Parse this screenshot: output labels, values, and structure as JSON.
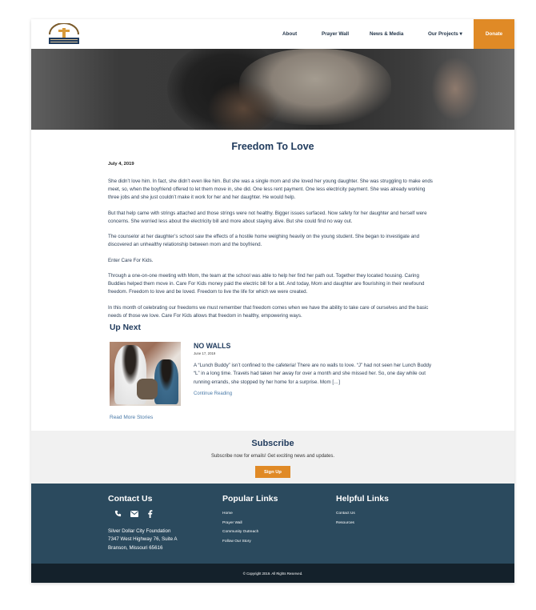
{
  "header": {
    "logo_alt": "Silver Dollar City Foundation",
    "nav": {
      "about": "About",
      "prayer_wall": "Prayer Wall",
      "news_media": "News & Media",
      "our_projects": "Our Projects",
      "donate": "Donate"
    }
  },
  "article": {
    "title": "Freedom To Love",
    "date": "July 4, 2019",
    "paragraphs": [
      "She didn’t love him. In fact, she didn’t even like him. But she was a single mom and she loved her young daughter. She was struggling to make ends meet, so, when the boyfriend offered to let them move in, she did. One less rent payment. One less electricity payment. She was already working three jobs and she just couldn’t make it work for her and her daughter. He would help.",
      "But that help came with strings attached and those strings were not healthy. Bigger issues surfaced. Now safety for her daughter and herself were concerns. She worried less about the electricity bill and more about staying alive. But she could find no way out.",
      "The counselor at her daughter’s school saw the effects of a hostile home weighing heavily on the young student. She began to investigate and discovered an unhealthy relationship between mom and the boyfriend.",
      "Enter Care For Kids.",
      "Through a one-on-one meeting with Mom, the team at the school was able to help her find her path out. Together they located housing. Caring Buddies helped them move in. Care For Kids money paid the electric bill for a bit. And today, Mom and daughter are flourishing in their newfound freedom. Freedom to love and be loved. Freedom to live the life for which we were created.",
      "In this month of celebrating our freedoms we must remember that freedom comes when we have the ability to take care of ourselves and the basic needs of those we love. Care For Kids allows that freedom in healthy, empowering ways."
    ]
  },
  "up_next": {
    "heading": "Up Next",
    "story": {
      "title": "NO WALLS",
      "date": "June 17, 2019",
      "excerpt": "A “Lunch Buddy” isn’t confined to the cafeteria! There are no walls to love. “J” had not seen her Lunch Buddy “L” in a long time. Travels had taken her away for over a month and she missed her. So, one day while out running errands, she stopped by her home for a surprise. Mom […]",
      "link": "Continue Reading"
    },
    "read_more": "Read More Stories"
  },
  "subscribe": {
    "title": "Subscribe",
    "text": "Subscribe now for emails! Get exciting news and updates.",
    "button": "Sign Up"
  },
  "footer": {
    "contact": {
      "title": "Contact Us",
      "icons": [
        "phone-icon",
        "email-icon",
        "facebook-icon"
      ],
      "address": [
        "Silver Dollar City Foundation",
        "7347 West Highway 76, Suite A",
        "Branson, Missouri 65616"
      ]
    },
    "popular": {
      "title": "Popular Links",
      "links": [
        "Home",
        "Prayer Wall",
        "Community Outreach",
        "Follow Our Story"
      ]
    },
    "helpful": {
      "title": "Helpful Links",
      "links": [
        "Contact Us",
        "Resources"
      ]
    },
    "copyright": "© Copyright 2019. All Rights Reserved."
  },
  "colors": {
    "accent": "#e08a26",
    "navy": "#1f3a5c",
    "footer": "#2b4a5e",
    "footer_bottom": "#14212b",
    "link": "#4a7aa8"
  }
}
